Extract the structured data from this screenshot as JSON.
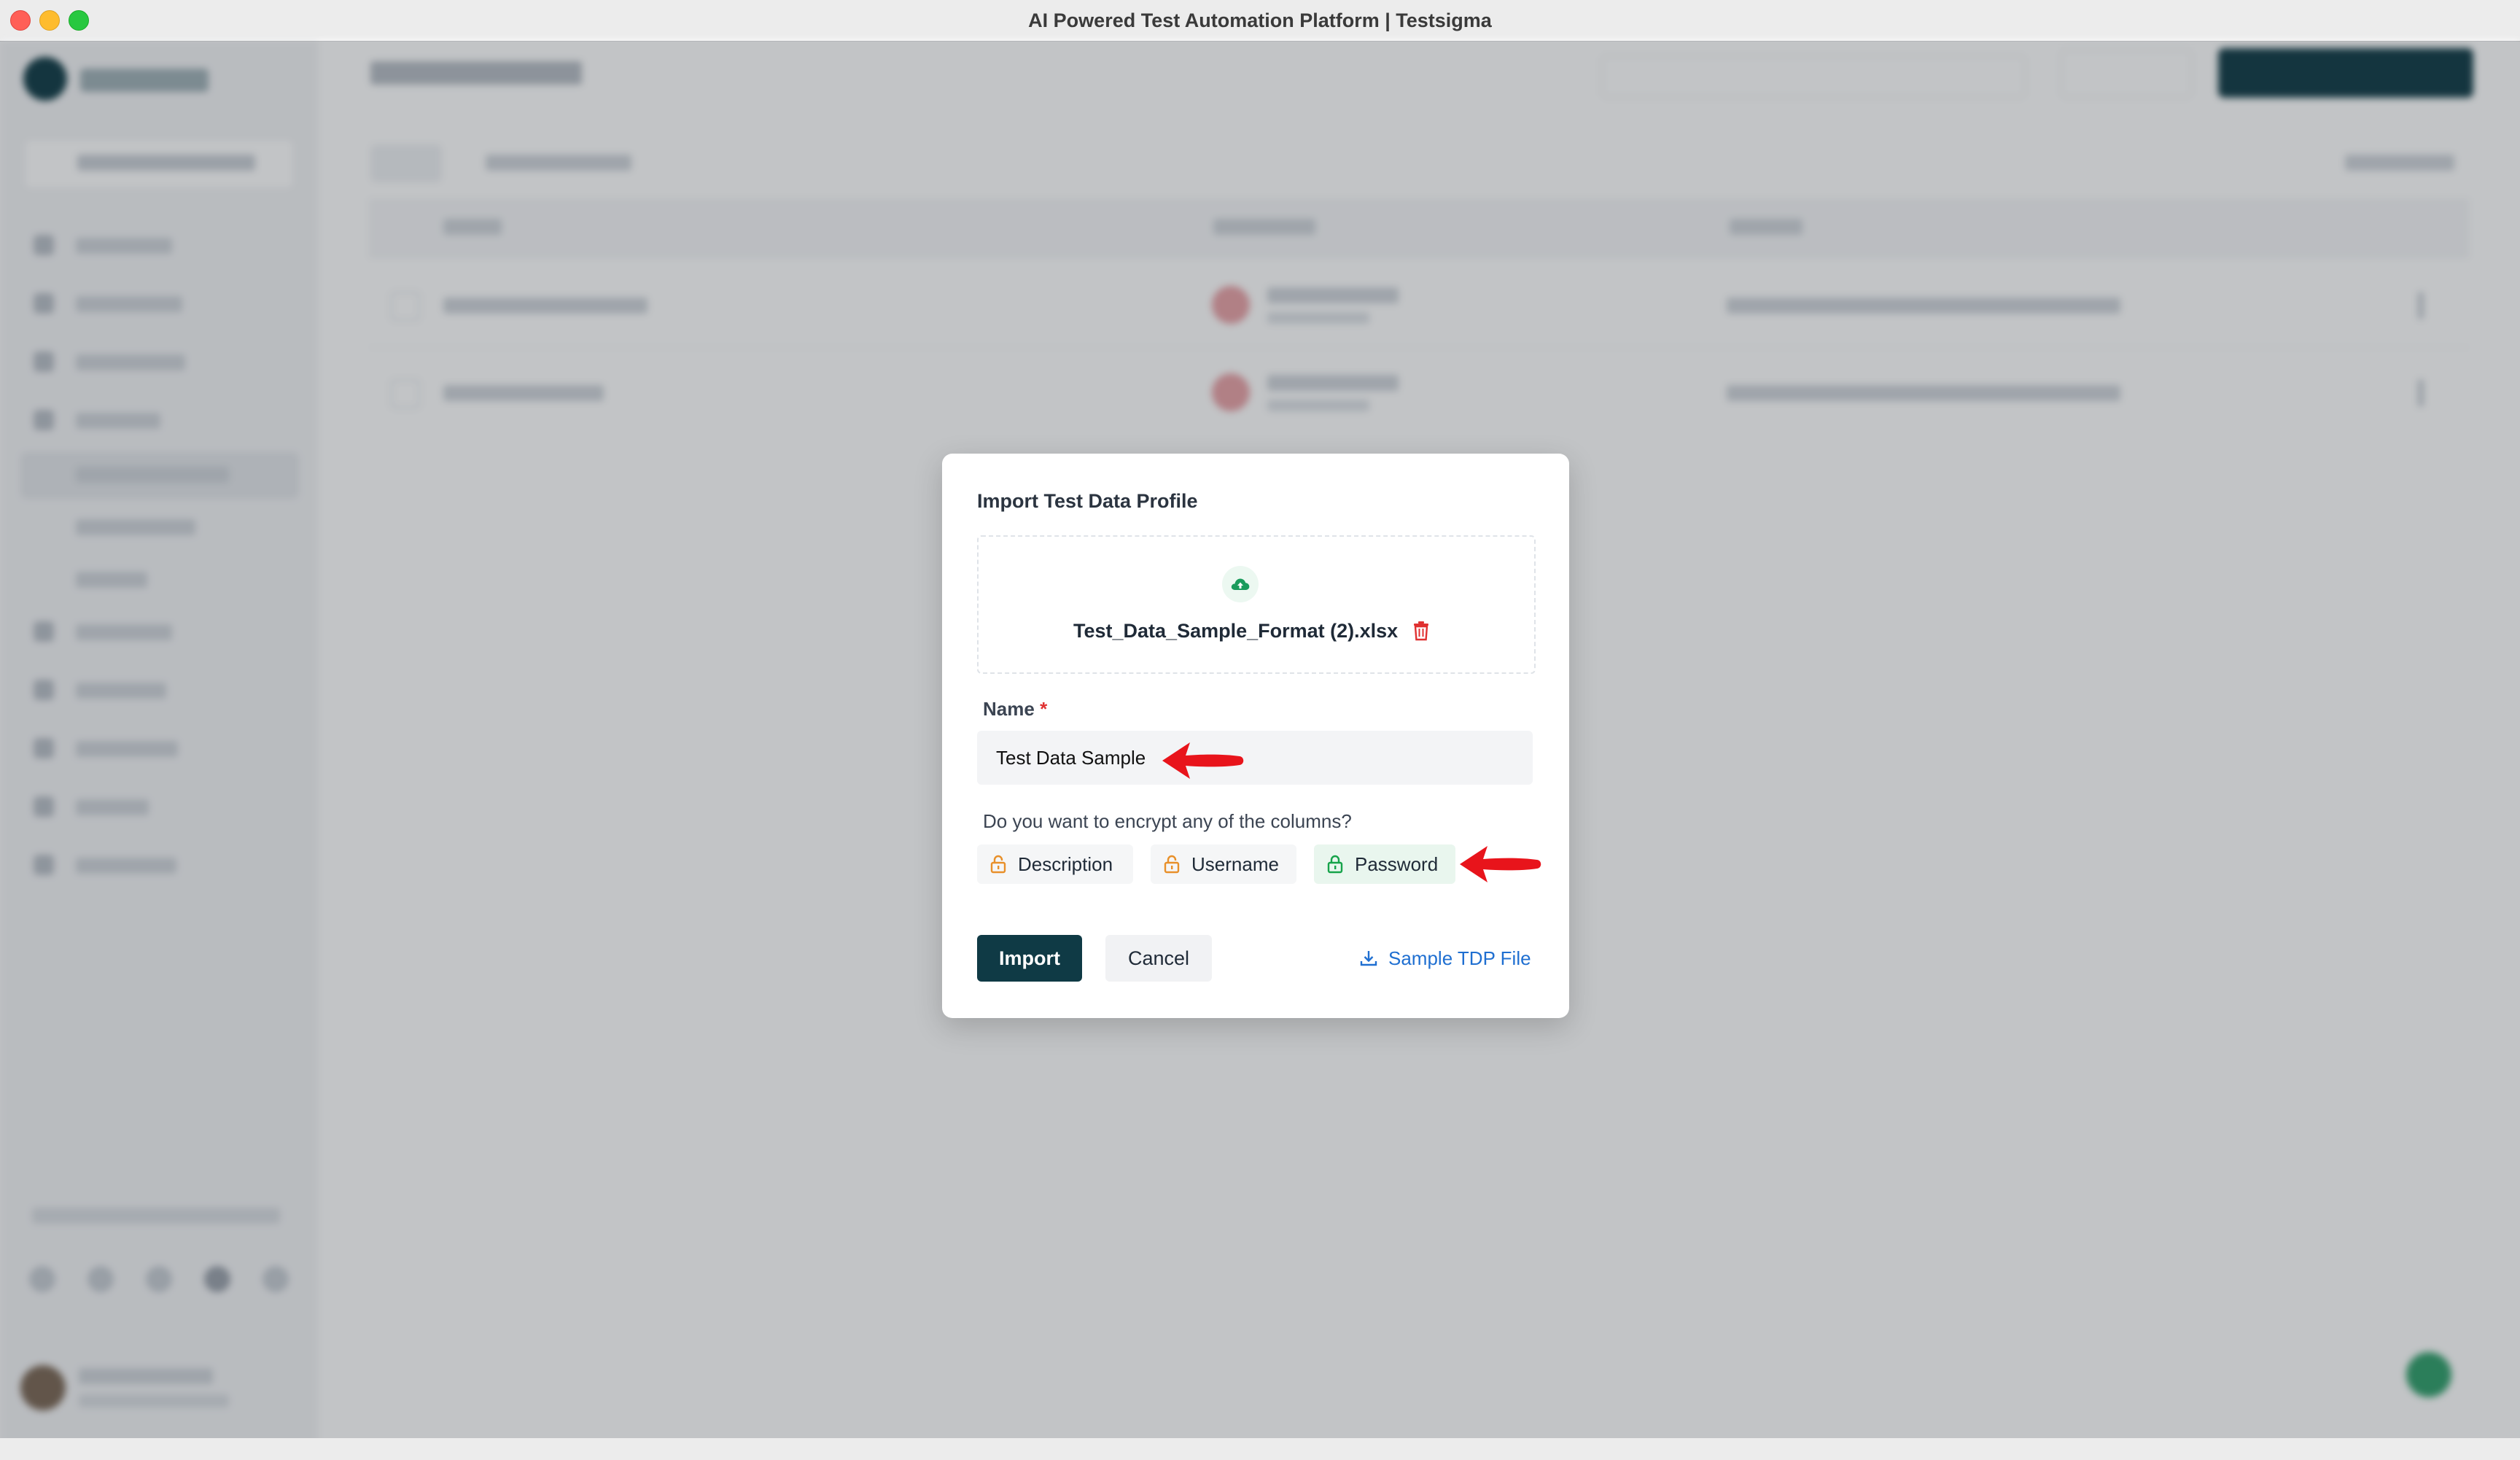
{
  "window": {
    "title": "AI Powered Test Automation Platform | Testsigma"
  },
  "modal": {
    "title": "Import Test Data Profile",
    "file_name": "Test_Data_Sample_Format (2).xlsx",
    "name_label": "Name",
    "required_mark": "*",
    "name_value": "Test Data Sample",
    "encrypt_question": "Do you want to encrypt any of the columns?",
    "columns": [
      {
        "label": "Description",
        "encrypted": false
      },
      {
        "label": "Username",
        "encrypted": false
      },
      {
        "label": "Password",
        "encrypted": true
      }
    ],
    "import_label": "Import",
    "cancel_label": "Cancel",
    "sample_link_label": "Sample TDP File"
  },
  "colors": {
    "primary": "#0f3a45",
    "success": "#16a34a",
    "unlocked": "#e8902a",
    "danger": "#e03131",
    "link": "#1f6fd1",
    "annotation_arrow": "#e8141b"
  }
}
